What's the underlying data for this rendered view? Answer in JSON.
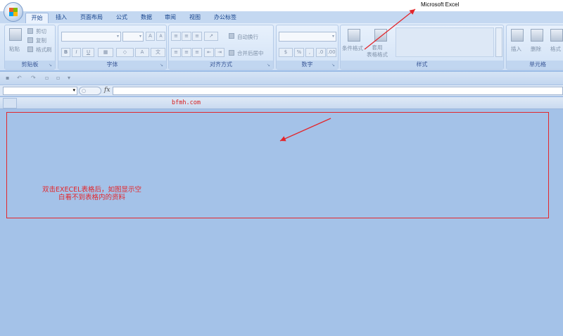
{
  "window": {
    "title": "Microsoft Excel"
  },
  "tabs": [
    "开始",
    "插入",
    "页面布局",
    "公式",
    "数据",
    "审阅",
    "视图",
    "办公标签"
  ],
  "ribbon": {
    "clipboard": {
      "label": "剪贴板",
      "paste": "粘贴",
      "cut": "剪切",
      "copy": "复制",
      "format_painter": "格式刷"
    },
    "font": {
      "label": "字体",
      "bold": "B",
      "italic": "I",
      "underline": "U",
      "grow": "A",
      "shrink": "A",
      "color": "A"
    },
    "alignment": {
      "label": "对齐方式",
      "wrap_text": "自动换行",
      "merge_center": "合并后居中"
    },
    "number": {
      "label": "数字",
      "percent": "%"
    },
    "styles": {
      "label": "样式",
      "conditional_format": "条件格式",
      "format_as_table": "套用\n表格格式"
    },
    "cells": {
      "label": "单元格",
      "insert": "插入",
      "delete": "删除",
      "format": "格式"
    }
  },
  "formula_bar": {
    "fx": "fx",
    "name_box_value": "",
    "formula_value": ""
  },
  "sheet": {
    "watermark": "bfmh.com"
  },
  "annotation": {
    "note": "双击EXECEL表格后，如图显示空白看不到表格内的资料",
    "color": "#e3262b"
  },
  "colors": {
    "background": "#a4c2e8",
    "ribbon": "#dfeafb",
    "accent": "#15428b"
  }
}
